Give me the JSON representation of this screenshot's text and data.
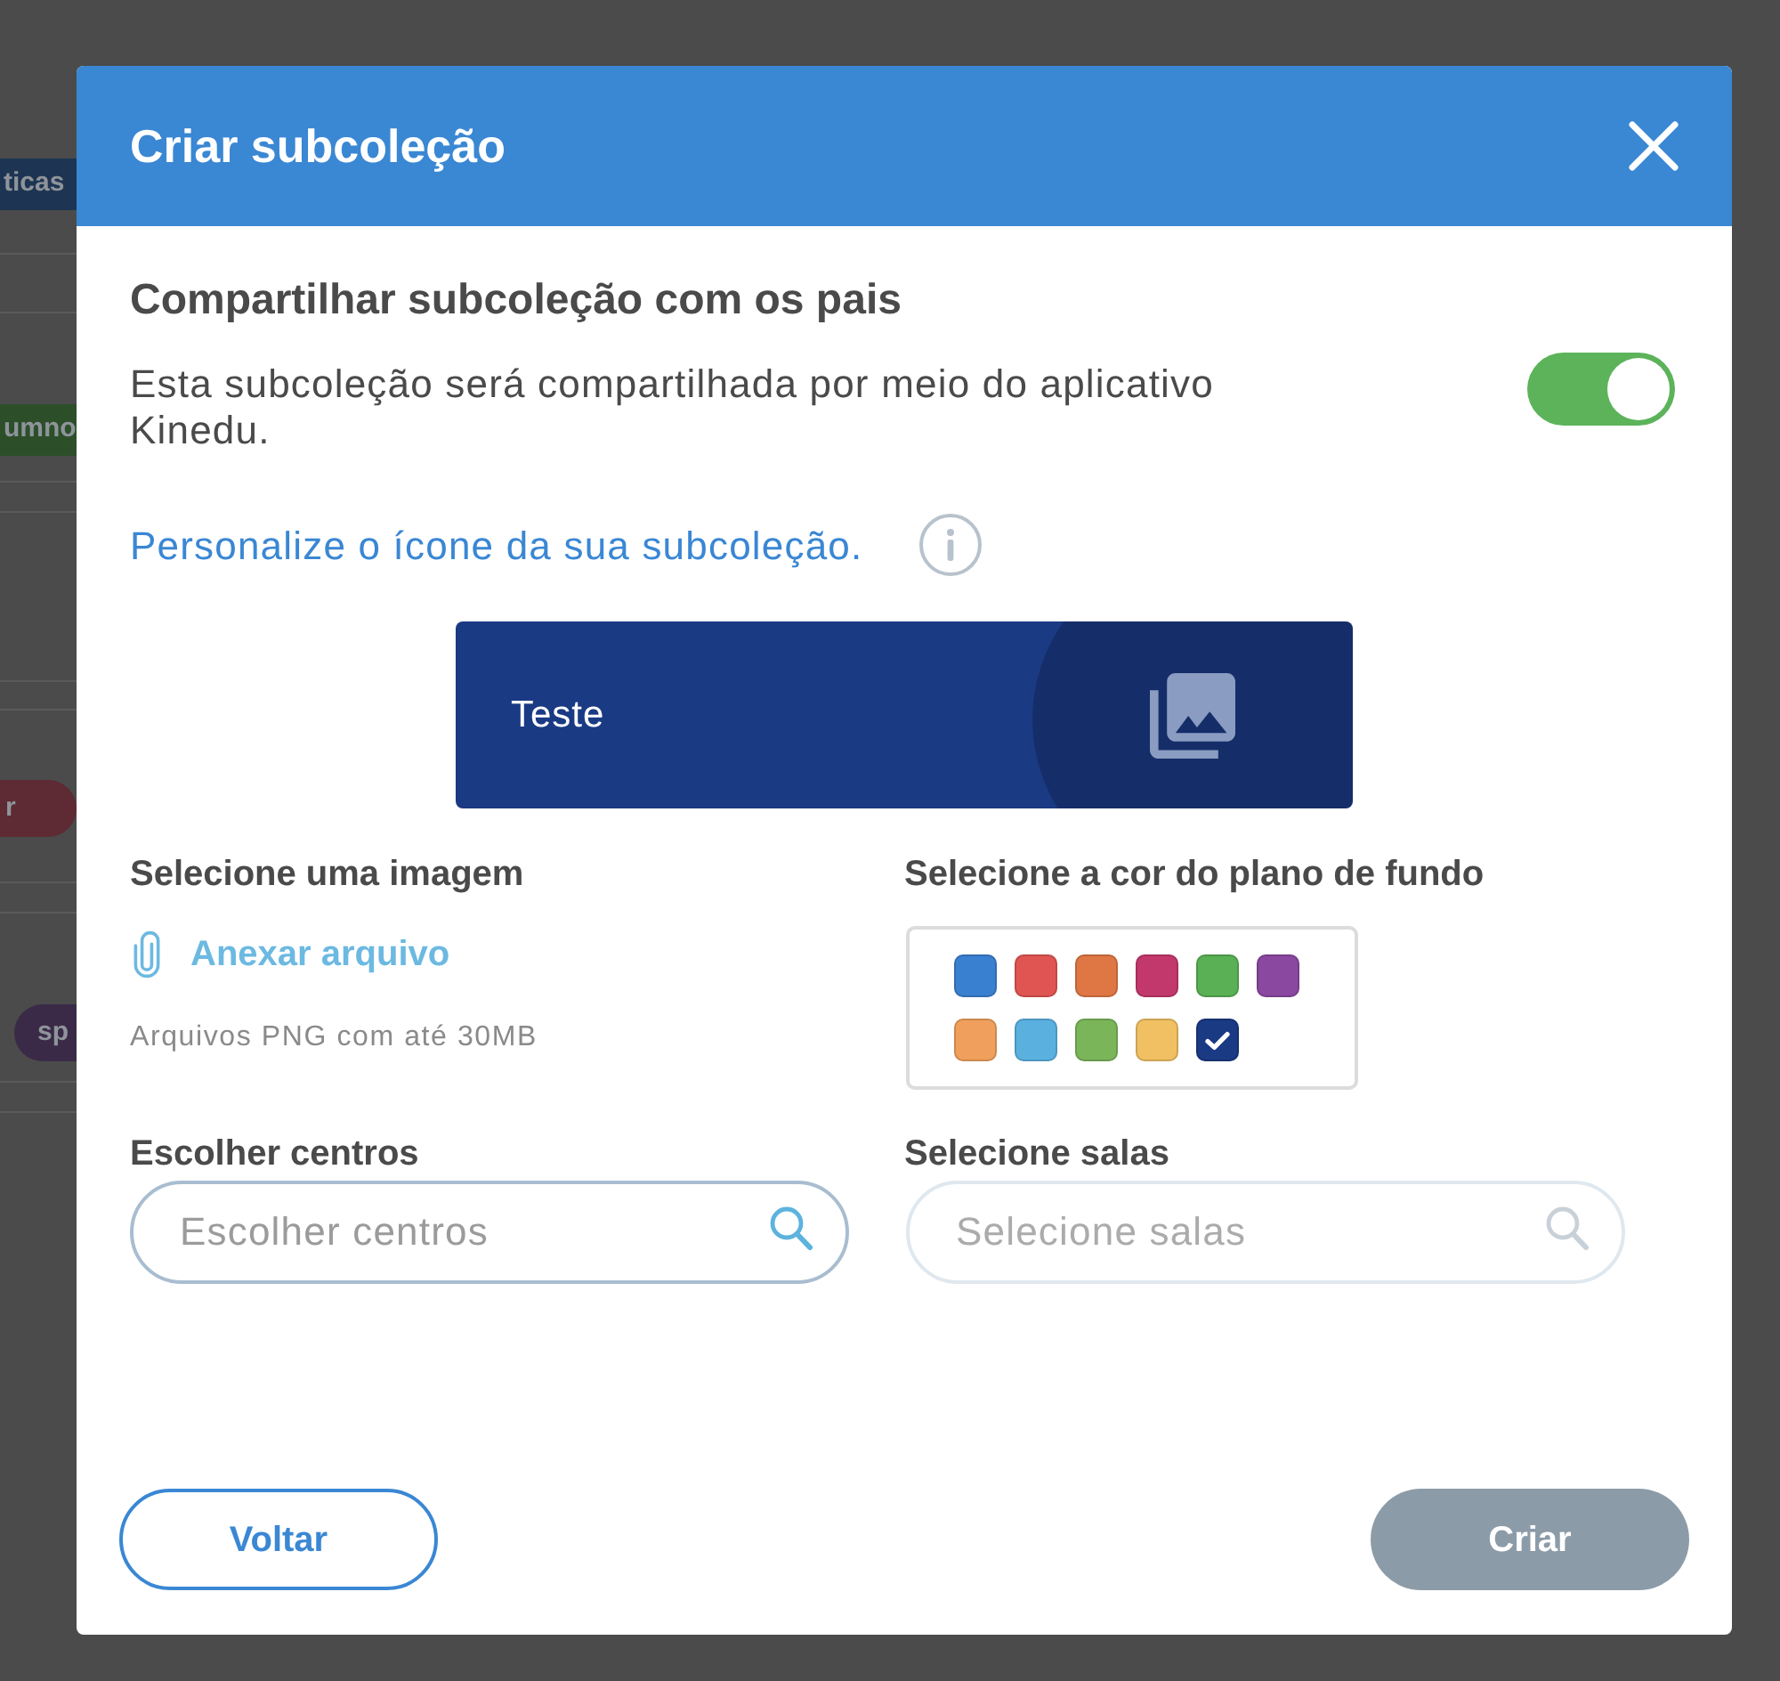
{
  "background": {
    "tags": [
      {
        "text": "ticas",
        "kind": "tag",
        "color": "#1d3553"
      },
      {
        "text": "umno",
        "kind": "tag",
        "color": "#2c4f2a"
      },
      {
        "text": "r",
        "kind": "pill",
        "color": "#5e2a33"
      },
      {
        "text": "sp",
        "kind": "pill",
        "color": "#3a2a48"
      }
    ]
  },
  "dialog": {
    "title": "Criar subcoleção",
    "share": {
      "heading": "Compartilhar subcoleção com os pais",
      "description": "Esta subcoleção será compartilhada por meio do aplicativo Kinedu.",
      "toggle": {
        "on": true
      }
    },
    "icon_link": "Personalize o ícone da sua subcoleção.",
    "preview": {
      "title": "Teste"
    },
    "image": {
      "label": "Selecione uma imagem",
      "attach_link": "Anexar arquivo",
      "hint": "Arquivos PNG com até 30MB"
    },
    "background_color": {
      "label": "Selecione a cor do plano de fundo",
      "swatches": [
        {
          "color": "#3a80d0",
          "selected": false
        },
        {
          "color": "#e05552",
          "selected": false
        },
        {
          "color": "#de7744",
          "selected": false
        },
        {
          "color": "#c3386c",
          "selected": false
        },
        {
          "color": "#5ab055",
          "selected": false
        },
        {
          "color": "#8b48a0",
          "selected": false
        },
        {
          "color": "#f0a05c",
          "selected": false
        },
        {
          "color": "#5ab1e0",
          "selected": false
        },
        {
          "color": "#7bb55a",
          "selected": false
        },
        {
          "color": "#f0c062",
          "selected": false
        },
        {
          "color": "#1b3a84",
          "selected": true
        }
      ]
    },
    "centers": {
      "label": "Escolher centros",
      "placeholder": "Escolher centros",
      "disabled": false
    },
    "rooms": {
      "label": "Selecione salas",
      "placeholder": "Selecione salas",
      "disabled": true
    },
    "buttons": [
      {
        "label": "Voltar",
        "kind": "secondary",
        "disabled": false
      },
      {
        "label": "Criar",
        "kind": "primary",
        "disabled": true
      }
    ]
  }
}
